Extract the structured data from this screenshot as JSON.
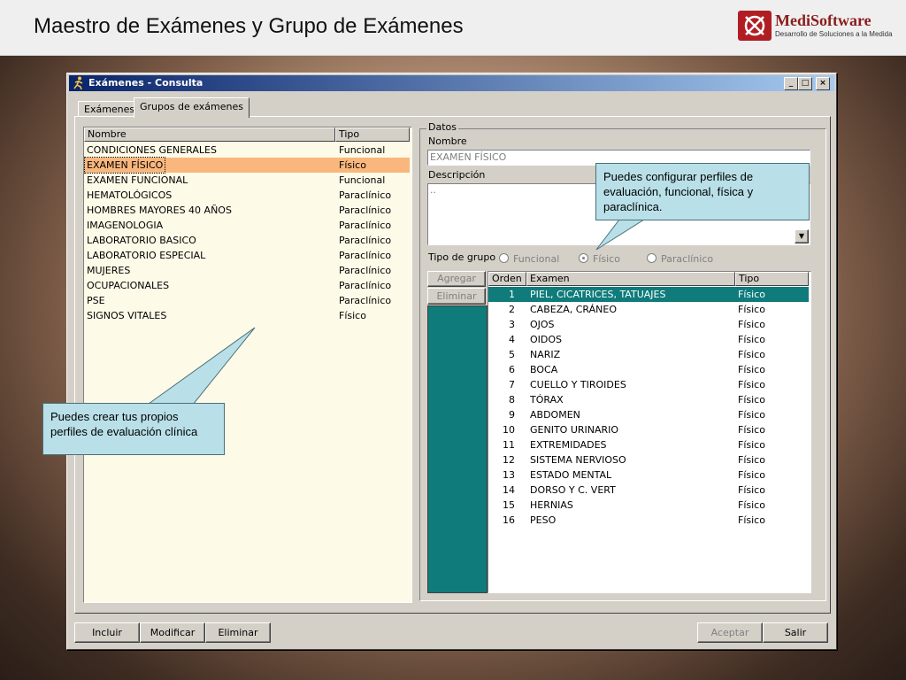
{
  "slide": {
    "title": "Maestro de Exámenes y Grupo de Exámenes",
    "brand_name": "MediSoftware",
    "brand_tagline": "Desarrollo de Soluciones a la Medida"
  },
  "window": {
    "title": "Exámenes - Consulta",
    "controls": {
      "minimize": "_",
      "maximize": "□",
      "close": "×"
    },
    "tabs": [
      {
        "label": "Exámenes",
        "active": false
      },
      {
        "label": "Grupos de exámenes",
        "active": true
      }
    ]
  },
  "groups_list": {
    "headers": {
      "name": "Nombre",
      "type": "Tipo"
    },
    "rows": [
      {
        "name": "CONDICIONES GENERALES",
        "type": "Funcional"
      },
      {
        "name": "EXAMEN FÍSICO",
        "type": "Físico",
        "selected": true
      },
      {
        "name": "EXAMEN FUNCIONAL",
        "type": "Funcional"
      },
      {
        "name": "HEMATOLÓGICOS",
        "type": "Paraclínico"
      },
      {
        "name": "HOMBRES MAYORES 40 AÑOS",
        "type": "Paraclínico"
      },
      {
        "name": "IMAGENOLOGIA",
        "type": "Paraclínico"
      },
      {
        "name": "LABORATORIO BASICO",
        "type": "Paraclínico"
      },
      {
        "name": "LABORATORIO ESPECIAL",
        "type": "Paraclínico"
      },
      {
        "name": "MUJERES",
        "type": "Paraclínico"
      },
      {
        "name": "OCUPACIONALES",
        "type": "Paraclínico"
      },
      {
        "name": "PSE",
        "type": "Paraclínico"
      },
      {
        "name": "SIGNOS VITALES",
        "type": "Físico"
      }
    ]
  },
  "details": {
    "group_label": "Datos",
    "name_label": "Nombre",
    "name_value": "EXAMEN FÍSICO",
    "description_label": "Descripción",
    "description_value": "..",
    "group_type_label": "Tipo de grupo",
    "group_type_options": [
      {
        "label": "Funcional",
        "checked": false
      },
      {
        "label": "Físico",
        "checked": true
      },
      {
        "label": "Paraclínico",
        "checked": false
      }
    ],
    "add_button": "Agregar",
    "remove_button": "Eliminar"
  },
  "exams_grid": {
    "headers": {
      "order": "Orden",
      "exam": "Examen",
      "type": "Tipo"
    },
    "rows": [
      {
        "order": "1",
        "exam": "PIEL, CICATRICES, TATUAJES",
        "type": "Físico",
        "selected": true
      },
      {
        "order": "2",
        "exam": "CABEZA, CRÁNEO",
        "type": "Físico"
      },
      {
        "order": "3",
        "exam": "OJOS",
        "type": "Físico"
      },
      {
        "order": "4",
        "exam": "OIDOS",
        "type": "Físico"
      },
      {
        "order": "5",
        "exam": "NARIZ",
        "type": "Físico"
      },
      {
        "order": "6",
        "exam": "BOCA",
        "type": "Físico"
      },
      {
        "order": "7",
        "exam": "CUELLO Y TIROIDES",
        "type": "Físico"
      },
      {
        "order": "8",
        "exam": "TÓRAX",
        "type": "Físico"
      },
      {
        "order": "9",
        "exam": "ABDOMEN",
        "type": "Físico"
      },
      {
        "order": "10",
        "exam": "GENITO URINARIO",
        "type": "Físico"
      },
      {
        "order": "11",
        "exam": "EXTREMIDADES",
        "type": "Físico"
      },
      {
        "order": "12",
        "exam": "SISTEMA NERVIOSO",
        "type": "Físico"
      },
      {
        "order": "13",
        "exam": "ESTADO MENTAL",
        "type": "Físico"
      },
      {
        "order": "14",
        "exam": "DORSO Y C. VERT",
        "type": "Físico"
      },
      {
        "order": "15",
        "exam": "HERNIAS",
        "type": "Físico"
      },
      {
        "order": "16",
        "exam": "PESO",
        "type": "Físico"
      }
    ]
  },
  "footer_buttons": {
    "include": "Incluir",
    "modify": "Modificar",
    "delete": "Eliminar",
    "accept": "Aceptar",
    "exit": "Salir"
  },
  "callouts": {
    "left": "Puedes crear tus propios perfiles de evaluación clínica",
    "right": "Puedes configurar perfiles de evaluación, funcional, física y paraclínica."
  },
  "colors": {
    "selection_list": "#f9b77d",
    "selection_grid": "#0f7b7b",
    "list_background": "#fefae8",
    "callout": "#b9e0e8",
    "title_bar": "#0a246a"
  },
  "icons": {
    "app": "running-figure-icon",
    "brand": "medisoftware-logo"
  }
}
